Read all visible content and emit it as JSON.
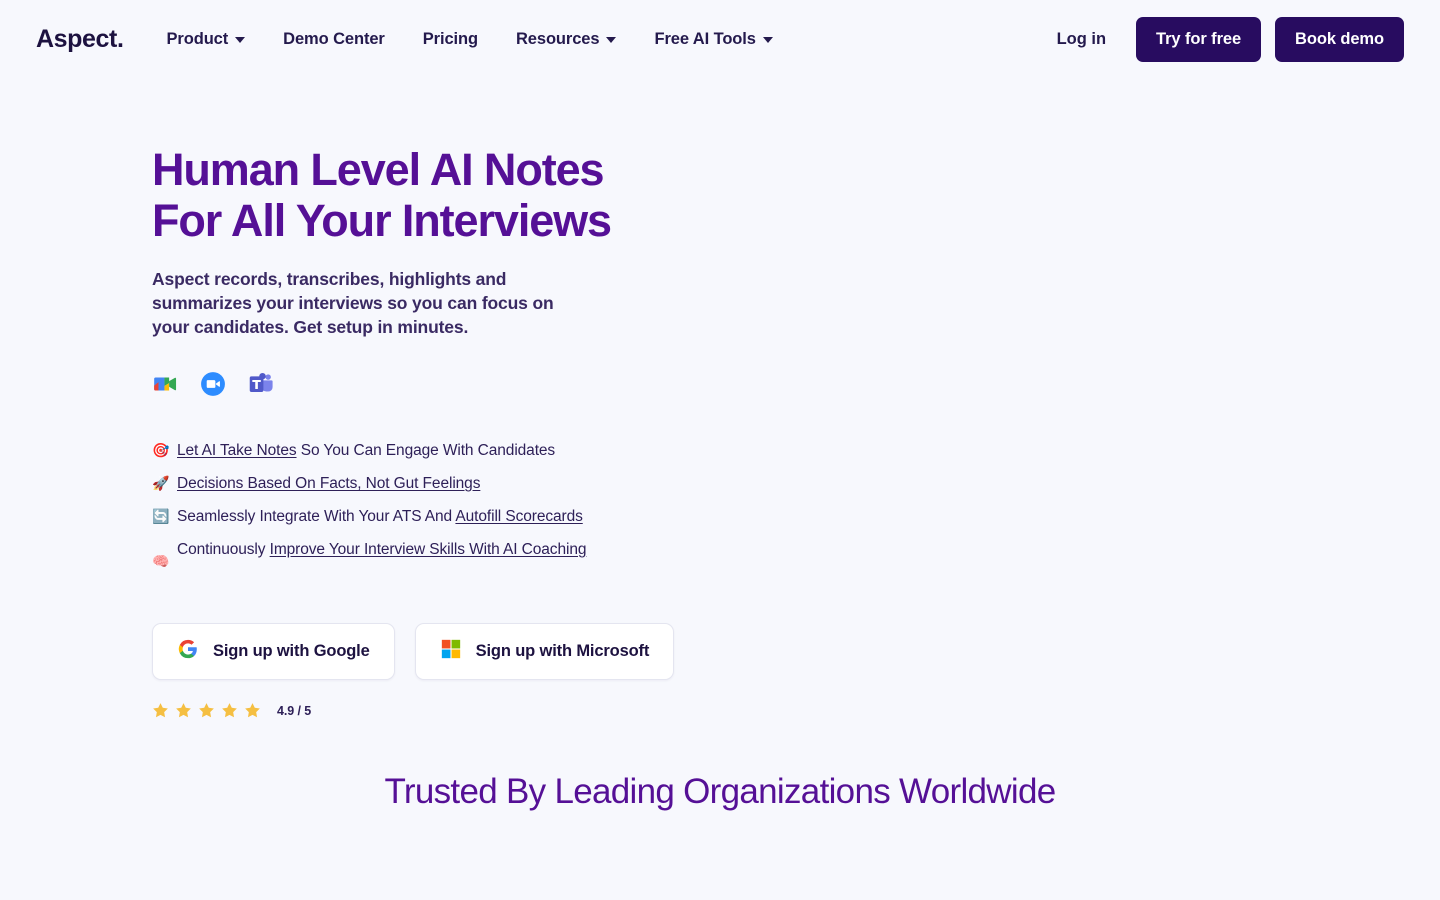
{
  "header": {
    "brand": "Aspect.",
    "nav": [
      {
        "label": "Product",
        "has_caret": true,
        "icon": "chevron-down-icon"
      },
      {
        "label": "Demo Center",
        "has_caret": false
      },
      {
        "label": "Pricing",
        "has_caret": false
      },
      {
        "label": "Resources",
        "has_caret": true,
        "icon": "chevron-down-icon"
      },
      {
        "label": "Free AI Tools",
        "has_caret": true,
        "icon": "chevron-down-icon"
      }
    ],
    "login_label": "Log in",
    "try_label": "Try for free",
    "demo_label": "Book demo"
  },
  "hero": {
    "title": "Human Level AI Notes\nFor All Your Interviews",
    "subtitle": "Aspect records, transcribes, highlights and\nsummarizes your interviews so you can focus on\nyour candidates. Get setup in minutes.",
    "platforms": [
      {
        "name": "google-meet-icon",
        "label": "Google Meet"
      },
      {
        "name": "zoom-icon",
        "label": "Zoom"
      },
      {
        "name": "microsoft-teams-icon",
        "label": "Microsoft Teams"
      }
    ],
    "features": [
      {
        "emoji": "🎯",
        "icon": "target-emoji-icon",
        "parts": [
          {
            "text": "Let AI Take Notes",
            "link": true
          },
          {
            "text": " So You Can Engage With Candidates",
            "link": false
          }
        ]
      },
      {
        "emoji": "🚀",
        "icon": "rocket-emoji-icon",
        "parts": [
          {
            "text": "Decisions Based On Facts, Not Gut Feelings",
            "link": true
          }
        ]
      },
      {
        "emoji": "🔄",
        "icon": "arrows-counterclockwise-emoji-icon",
        "parts": [
          {
            "text": "Seamlessly Integrate With Your  ATS And ",
            "link": false
          },
          {
            "text": "Autofill Scorecards",
            "link": true
          }
        ]
      },
      {
        "emoji": "🧠",
        "icon": "brain-emoji-icon",
        "multiline": true,
        "parts": [
          {
            "text": "Continuously ",
            "link": false
          },
          {
            "text": "Improve Your Interview Skills With AI Coaching",
            "link": true
          }
        ]
      }
    ],
    "signup": [
      {
        "label": "Sign up with Google",
        "icon": "google-logo-icon"
      },
      {
        "label": "Sign up with Microsoft",
        "icon": "microsoft-logo-icon"
      }
    ],
    "rating": {
      "stars": 5,
      "star_icon": "star-icon",
      "value": "4.9 / 5",
      "star_color": "#f5bf42"
    }
  },
  "trusted": {
    "heading": "Trusted By Leading Organizations Worldwide"
  },
  "colors": {
    "page_background": "#f7f8fd",
    "brand_purple": "#551096",
    "dark_navy": "#241a4d",
    "button_dark": "#280c60",
    "star_gold": "#f5bf42"
  }
}
